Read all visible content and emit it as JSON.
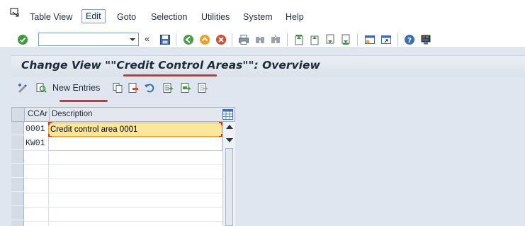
{
  "menubar": {
    "items": [
      "Table View",
      "Edit",
      "Goto",
      "Selection",
      "Utilities",
      "System",
      "Help"
    ],
    "selected": "Edit"
  },
  "toolbar": {
    "command_field_value": "",
    "chevron": "«"
  },
  "title": {
    "text": "Change View \"\"Credit Control Areas\"\": Overview"
  },
  "app_toolbar": {
    "new_entries_label": "New Entries"
  },
  "table": {
    "columns": [
      "CCAr",
      "Description"
    ],
    "rows": [
      {
        "code": "0001",
        "description": "Credit control area 0001"
      },
      {
        "code": "KW01",
        "description": ""
      }
    ]
  },
  "colors": {
    "background": "#dfe6ef",
    "active_cell": "#fbe79b",
    "annotation_red": "#d9322a"
  }
}
